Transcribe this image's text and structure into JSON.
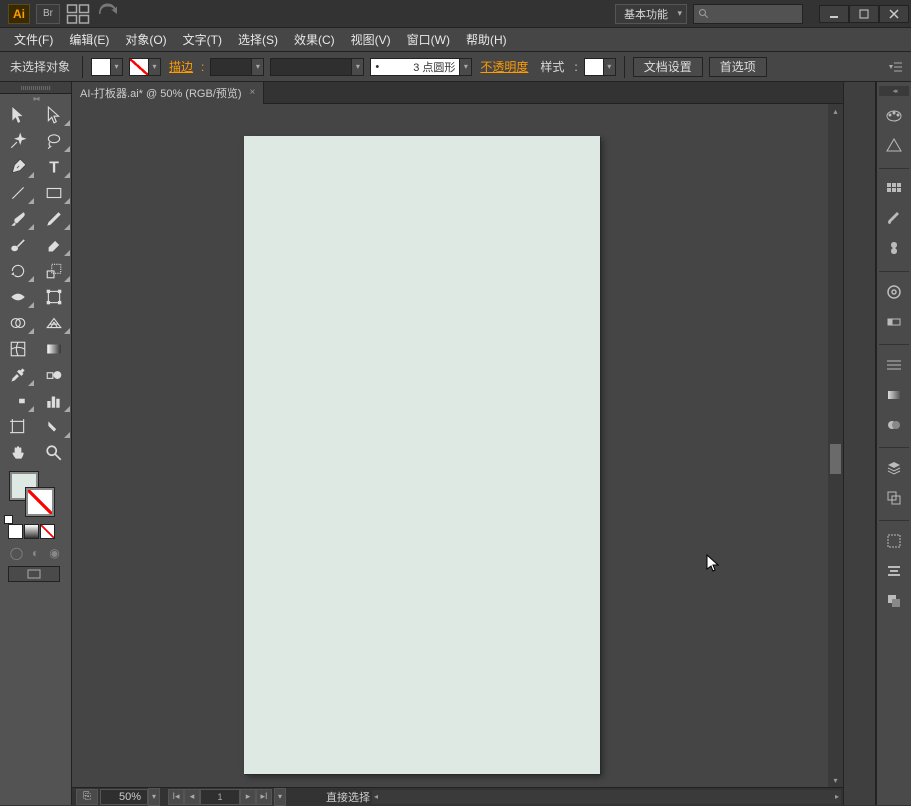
{
  "titlebar": {
    "logo": "Ai",
    "br_label": "Br",
    "workspace": "基本功能",
    "search_placeholder": ""
  },
  "menu": {
    "items": [
      "文件(F)",
      "编辑(E)",
      "对象(O)",
      "文字(T)",
      "选择(S)",
      "效果(C)",
      "视图(V)",
      "窗口(W)",
      "帮助(H)"
    ]
  },
  "controlbar": {
    "no_selection": "未选择对象",
    "stroke_label": "描边",
    "stroke_style": "3 点圆形",
    "opacity_label": "不透明度",
    "style_label": "样式",
    "doc_setup": "文档设置",
    "prefs": "首选项"
  },
  "document": {
    "tab_title": "AI-打板器.ai* @ 50% (RGB/预览)",
    "zoom": "50%",
    "artboard_num": "1",
    "status_tool": "直接选择"
  },
  "tools": {
    "left": [
      "selection",
      "direct-selection",
      "magic-wand",
      "lasso",
      "pen",
      "type",
      "line",
      "rectangle",
      "paintbrush",
      "pencil",
      "blob-brush",
      "eraser",
      "rotate",
      "scale",
      "width",
      "free-transform",
      "shape-builder",
      "perspective",
      "mesh",
      "gradient",
      "eyedropper",
      "blend",
      "symbol-sprayer",
      "graph",
      "artboard",
      "slice",
      "hand",
      "zoom"
    ],
    "right": [
      "color",
      "color-guide",
      "swatches",
      "brushes",
      "symbols",
      "stroke",
      "gradient-panel",
      "transparency",
      "appearance",
      "graphic-styles",
      "layers",
      "artboards",
      "transform",
      "align",
      "pathfinder"
    ]
  },
  "colors": {
    "artboard_fill": "#dde9e2",
    "accent": "#ff9a00"
  }
}
